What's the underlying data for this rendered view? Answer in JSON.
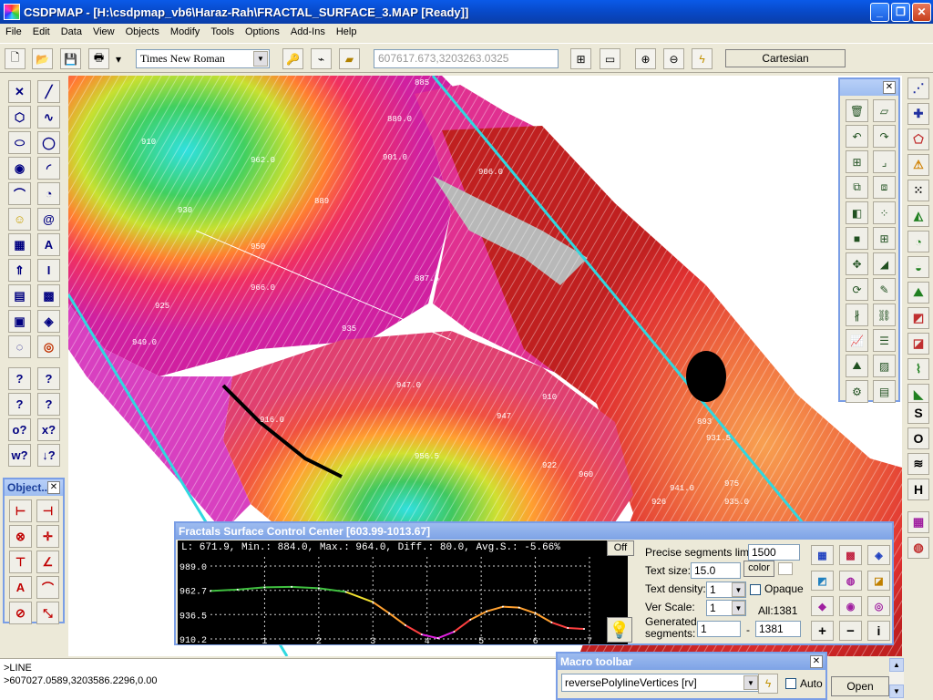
{
  "window": {
    "title": "CSDPMAP - [H:\\csdpmap_vb6\\Haraz-Rah\\FRACTAL_SURFACE_3.MAP [Ready]]",
    "minimize": "_",
    "restore": "❐",
    "close": "✕"
  },
  "menu": [
    "File",
    "Edit",
    "Data",
    "View",
    "Objects",
    "Modify",
    "Tools",
    "Options",
    "Add-Ins",
    "Help"
  ],
  "toolbar": {
    "font": "Times New Roman",
    "coordinate_placeholder": "607617.673,3203263.0325",
    "projection": "Cartesian"
  },
  "object_panel": {
    "title": "Object...",
    "close": "✕"
  },
  "right_panel": {
    "close": "✕"
  },
  "right_strip": {
    "s": "S",
    "o": "O",
    "h": "H"
  },
  "map": {
    "contour_labels": [
      "885",
      "889.0",
      "910",
      "962.0",
      "901.0",
      "906.0",
      "930",
      "889",
      "950",
      "966.0",
      "925",
      "887.5",
      "935",
      "952",
      "949.0",
      "916.0",
      "947.0",
      "910",
      "922",
      "960",
      "893",
      "931.5",
      "956.5",
      "947",
      "975",
      "941.0",
      "926",
      "935.0"
    ]
  },
  "fractal_panel": {
    "title": "Fractals Surface Control Center [603.99-1013.67]",
    "stats": "L: 671.9, Min.: 884.0, Max.: 964.0, Diff.: 80.0, Avg.S.: -5.66%",
    "off_button": "Off",
    "precise_limit_label": "Precise segments limit:",
    "precise_limit_value": "1500",
    "text_size_label": "Text size:",
    "text_size_value": "15.0",
    "color_button": "color",
    "text_density_label": "Text density:",
    "text_density_value": "1",
    "opaque_label": "Opaque",
    "ver_scale_label": "Ver Scale:",
    "ver_scale_value": "1",
    "all_count": "All:1381",
    "generated_label_1": "Generated",
    "generated_label_2": "segments:",
    "generated_from": "1",
    "generated_dash": "-",
    "generated_to": "1381",
    "plus": "+",
    "minus": "−",
    "info": "i"
  },
  "chart_data": {
    "type": "line",
    "y_ticks": [
      "989.0",
      "962.7",
      "936.5",
      "910.2"
    ],
    "x_ticks": [
      "1",
      "2",
      "3",
      "4",
      "5",
      "6",
      "7"
    ],
    "ylim": [
      910.2,
      989.0
    ],
    "xlim": [
      0,
      7
    ],
    "grid": true,
    "x": [
      0,
      0.5,
      1,
      1.5,
      2,
      2.5,
      3,
      3.3,
      3.6,
      3.9,
      4.2,
      4.5,
      4.8,
      5.1,
      5.4,
      5.7,
      6,
      6.3,
      6.6,
      6.9
    ],
    "values": [
      962.0,
      963.5,
      966.0,
      966.5,
      965.0,
      961.0,
      950.0,
      938.0,
      925.0,
      915.0,
      911.0,
      918.0,
      931.0,
      940.0,
      945.0,
      944.0,
      938.0,
      928.0,
      922.0,
      921.0
    ]
  },
  "command": {
    "line1": ">LINE",
    "line2": ">607027.0589,3203586.2296,0.00"
  },
  "macro": {
    "title": "Macro toolbar",
    "close": "✕",
    "selected": "reversePolylineVertices [rv]",
    "auto_label": "Auto",
    "open_button": "Open"
  },
  "colors": {
    "title_blue": "#0849c8",
    "panel_border": "#7a9ee6",
    "cyan_line": "#2fd8e0"
  }
}
